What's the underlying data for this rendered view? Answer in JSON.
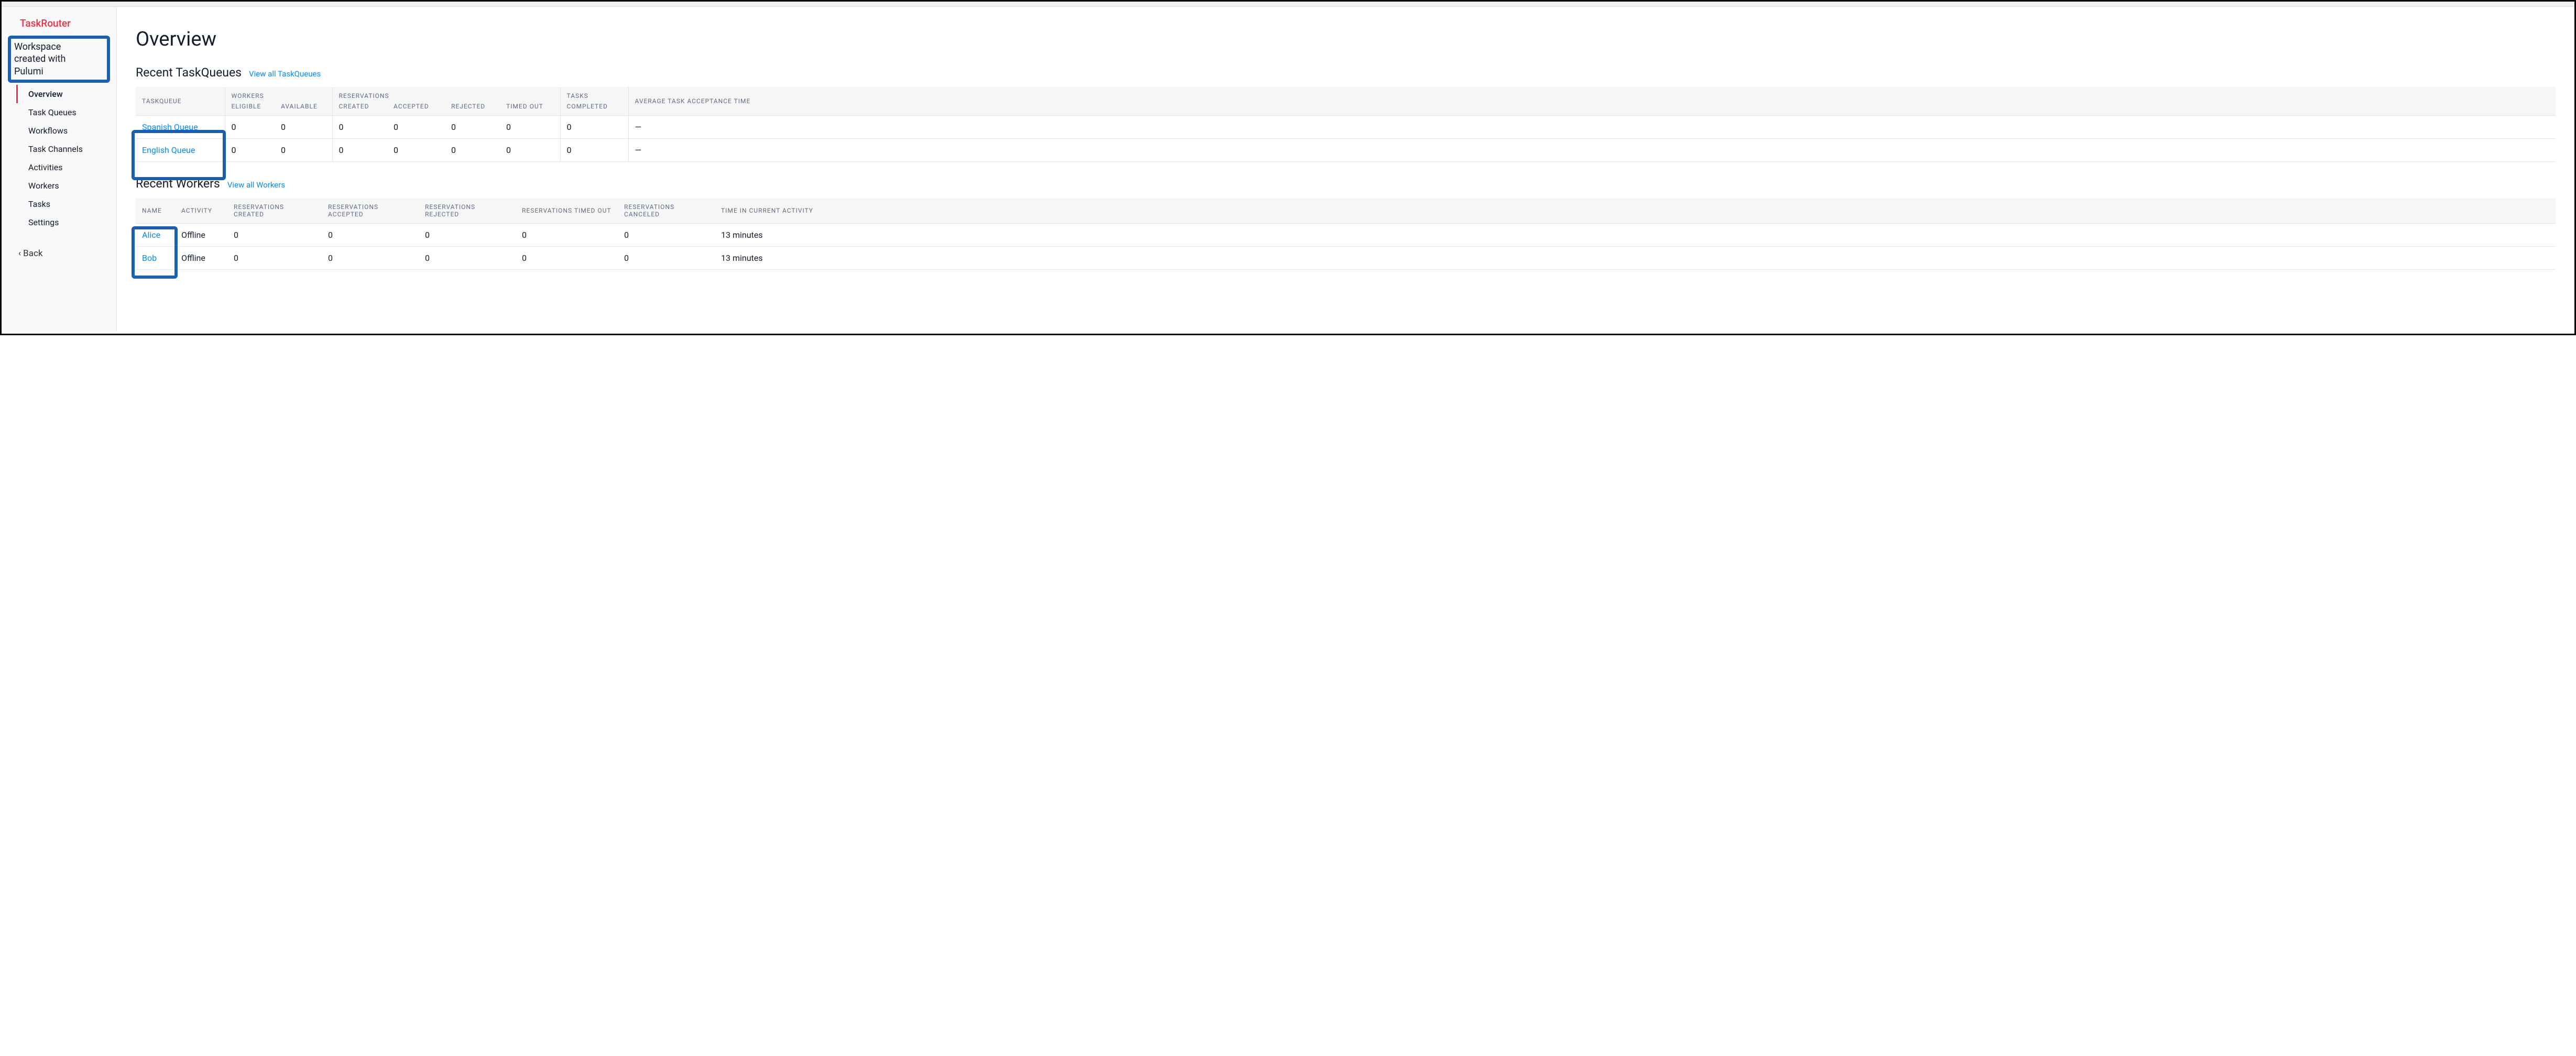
{
  "brand": "TaskRouter",
  "workspace": {
    "line1": "Workspace",
    "line2": "created with",
    "line3": "Pulumi"
  },
  "nav": {
    "items": [
      {
        "label": "Overview",
        "active": true
      },
      {
        "label": "Task Queues",
        "active": false
      },
      {
        "label": "Workflows",
        "active": false
      },
      {
        "label": "Task Channels",
        "active": false
      },
      {
        "label": "Activities",
        "active": false
      },
      {
        "label": "Workers",
        "active": false
      },
      {
        "label": "Tasks",
        "active": false
      },
      {
        "label": "Settings",
        "active": false
      }
    ]
  },
  "back": {
    "chevron": "‹",
    "label": "Back"
  },
  "page": {
    "title": "Overview"
  },
  "taskqueues": {
    "title": "Recent TaskQueues",
    "view_all": "View all TaskQueues",
    "headers": {
      "name": "TASKQUEUE",
      "workers": "WORKERS",
      "eligible": "ELIGIBLE",
      "available": "AVAILABLE",
      "reservations": "RESERVATIONS",
      "created": "CREATED",
      "accepted": "ACCEPTED",
      "rejected": "REJECTED",
      "timed_out": "TIMED OUT",
      "tasks": "TASKS",
      "completed": "COMPLETED",
      "avg": "AVERAGE TASK ACCEPTANCE TIME"
    },
    "rows": [
      {
        "name": "Spanish Queue",
        "eligible": "0",
        "available": "0",
        "created": "0",
        "accepted": "0",
        "rejected": "0",
        "timed_out": "0",
        "completed": "0",
        "avg": "—"
      },
      {
        "name": "English Queue",
        "eligible": "0",
        "available": "0",
        "created": "0",
        "accepted": "0",
        "rejected": "0",
        "timed_out": "0",
        "completed": "0",
        "avg": "—"
      }
    ]
  },
  "workers": {
    "title": "Recent Workers",
    "view_all": "View all Workers",
    "headers": {
      "name": "NAME",
      "activity": "ACTIVITY",
      "created": "RESERVATIONS CREATED",
      "accepted": "RESERVATIONS ACCEPTED",
      "rejected": "RESERVATIONS REJECTED",
      "timed_out": "RESERVATIONS TIMED OUT",
      "canceled": "RESERVATIONS CANCELED",
      "time": "TIME IN CURRENT ACTIVITY"
    },
    "rows": [
      {
        "name": "Alice",
        "activity": "Offline",
        "created": "0",
        "accepted": "0",
        "rejected": "0",
        "timed_out": "0",
        "canceled": "0",
        "time": "13 minutes"
      },
      {
        "name": "Bob",
        "activity": "Offline",
        "created": "0",
        "accepted": "0",
        "rejected": "0",
        "timed_out": "0",
        "canceled": "0",
        "time": "13 minutes"
      }
    ]
  }
}
